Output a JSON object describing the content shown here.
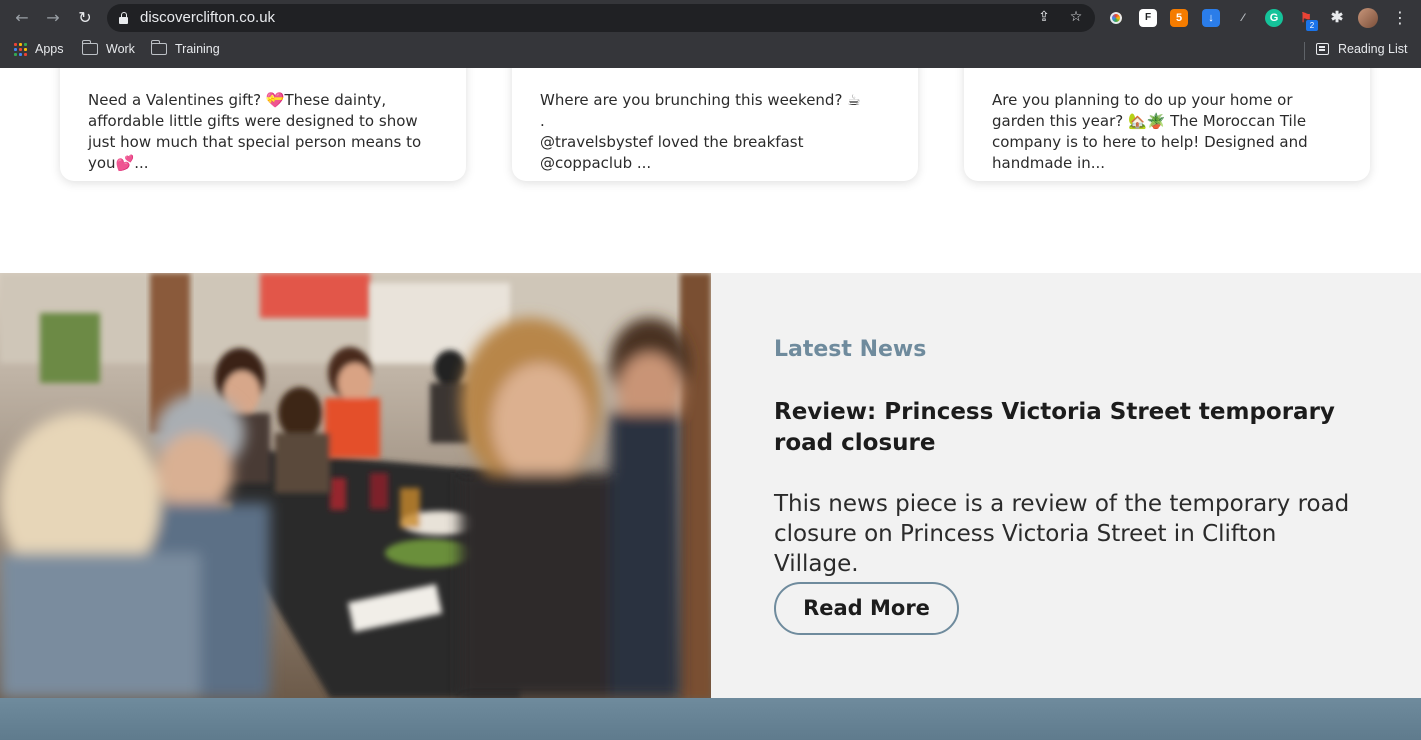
{
  "browser": {
    "url": "discoverclifton.co.uk",
    "bookmarks": [
      {
        "label": "Apps"
      },
      {
        "label": "Work"
      },
      {
        "label": "Training"
      }
    ],
    "reading_list_label": "Reading List",
    "extension_badge": "2",
    "icons": [
      "back-arrow-icon",
      "forward-arrow-icon",
      "reload-icon",
      "lock-icon",
      "share-icon",
      "bookmark-star-icon",
      "extensions-puzzle-icon",
      "kebab-menu-icon"
    ]
  },
  "social_cards": [
    {
      "text": "Need a Valentines gift? 💝These dainty, affordable little gifts were designed to show just how much that special person means to you💕..."
    },
    {
      "text": "Where are you brunching this weekend? ☕\n.\n@travelsbystef loved the breakfast @coppaclub ..."
    },
    {
      "text": "Are you planning to do up your home or garden this year? 🏡🪴 The Moroccan Tile company is to here to help! Designed and handmade in..."
    }
  ],
  "news": {
    "label": "Latest News",
    "title": "Review: Princess Victoria Street temporary road closure",
    "body": "This news piece is a review of the temporary road closure on Princess Victoria Street in Clifton Village.",
    "button_label": "Read More"
  },
  "colors": {
    "accent": "#6f8b9d",
    "chrome_bg": "#35363a",
    "omnibox_bg": "#202124",
    "news_bg": "#f2f2f2"
  }
}
